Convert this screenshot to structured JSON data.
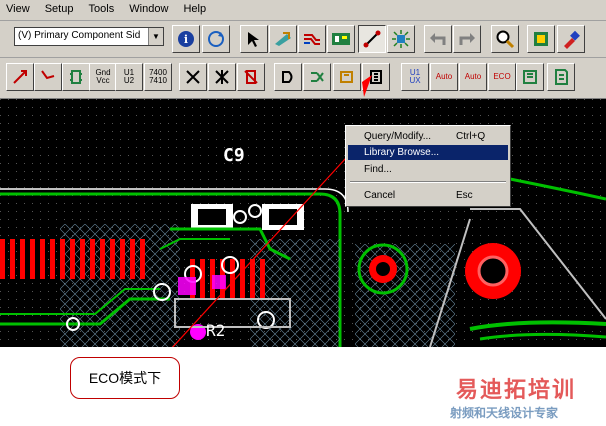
{
  "menu": [
    "View",
    "Setup",
    "Tools",
    "Window",
    "Help"
  ],
  "toolbar1": {
    "layer_combo_value": "(V) Primary Component Sid",
    "buttons": [
      "info-icon",
      "refresh-icon",
      "select-arrow-icon",
      "drafting-icon",
      "route-icon",
      "design-icon",
      "eco-icon",
      "design-verify-icon",
      "undo-icon",
      "redo-icon",
      "zoom-icon",
      "library-icon",
      "paint-icon"
    ]
  },
  "toolbar2": {
    "buttons": [
      {
        "name": "add-connection-icon",
        "label": ""
      },
      {
        "name": "add-route-icon",
        "label": ""
      },
      {
        "name": "add-component-icon",
        "label": ""
      },
      {
        "name": "gnd-vcc-button",
        "label": "Gnd\nVcc"
      },
      {
        "name": "swap-u1-u2-button",
        "label": "U1\nU2"
      },
      {
        "name": "gate-swap-7400-button",
        "label": "7400\n7410"
      },
      {
        "name": "delete-connection-icon",
        "label": ""
      },
      {
        "name": "delete-net-icon",
        "label": ""
      },
      {
        "name": "delete-component-icon",
        "label": ""
      },
      {
        "name": "add-gate-icon",
        "label": ""
      },
      {
        "name": "swap-gate-icon",
        "label": ""
      },
      {
        "name": "change-component-icon",
        "label": ""
      },
      {
        "name": "change-part-icon",
        "label": ""
      },
      {
        "name": "rename-ux-button",
        "label": "U1\nUX"
      },
      {
        "name": "auto-renumber-button",
        "label": "Auto"
      },
      {
        "name": "auto-ref-button",
        "label": "Auto"
      },
      {
        "name": "eco-options-button",
        "label": "ECO"
      },
      {
        "name": "eco-report-icon",
        "label": ""
      },
      {
        "name": "eco-file-icon",
        "label": ""
      }
    ]
  },
  "context_menu": {
    "items": [
      {
        "label": "Query/Modify...",
        "shortcut": "Ctrl+Q",
        "selected": false
      },
      {
        "label": "Library Browse...",
        "shortcut": "",
        "selected": true
      },
      {
        "label": "Find...",
        "shortcut": "",
        "selected": false
      },
      {
        "label": "Cancel",
        "shortcut": "Esc",
        "selected": false
      }
    ]
  },
  "pcb": {
    "ref_c9": "C9",
    "ref_r2": "R2"
  },
  "callout": {
    "text": "ECO模式下"
  },
  "watermark": {
    "title": "易迪拓培训",
    "subtitle": "射频和天线设计专家"
  },
  "colors": {
    "canvas": "#000000",
    "copper": "#ff0000",
    "silk": "#ffffff",
    "outline": "#00c000",
    "magenta": "#ff00ff",
    "highlight": "#0a246a"
  }
}
